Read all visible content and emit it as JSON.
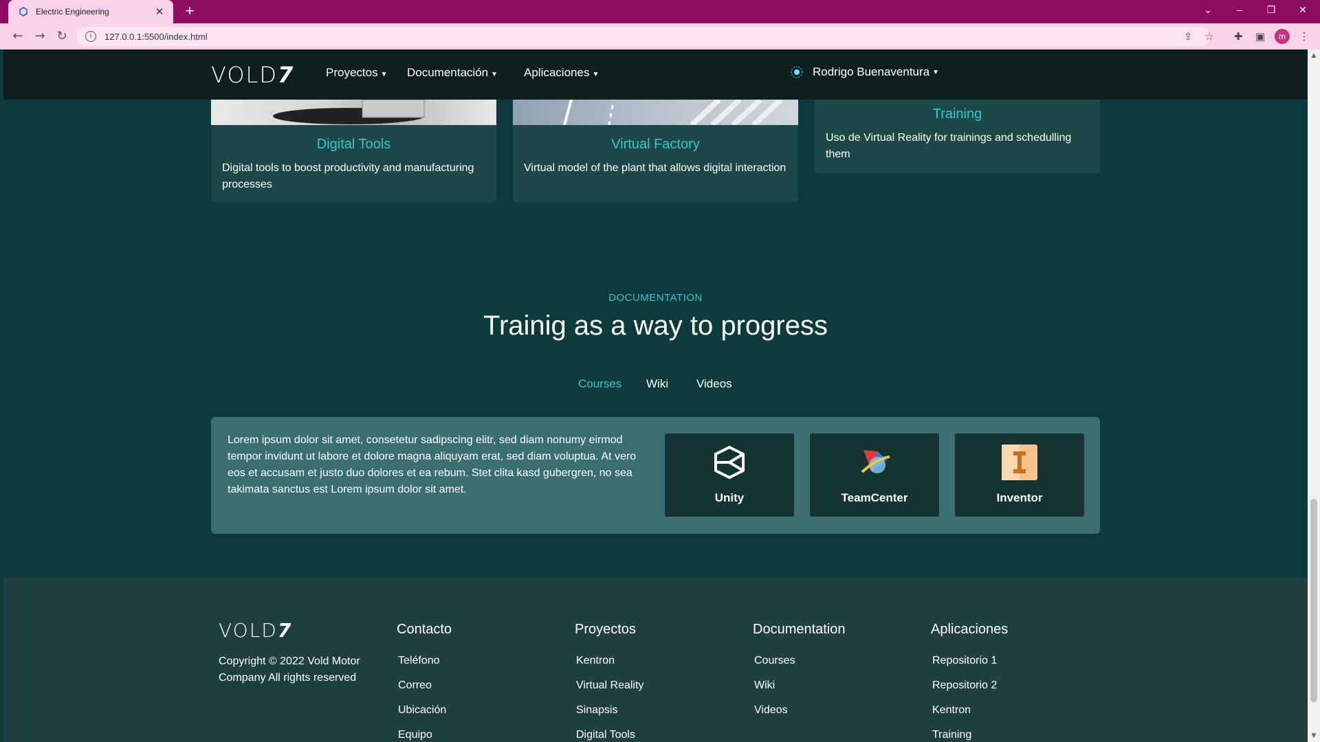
{
  "browser": {
    "tab_title": "Electric Engineering",
    "url": "127.0.0.1:5500/index.html",
    "profile_initial": "m"
  },
  "nav": {
    "logo": "VOLD",
    "logo_mark": "7",
    "menus": [
      "Proyectos",
      "Documentación",
      "Aplicaciones"
    ],
    "user": "Rodrigo Buenaventura"
  },
  "cards": [
    {
      "title": "Digital Tools",
      "text": "Digital tools to boost productivity and manufacturing processes"
    },
    {
      "title": "Virtual Factory",
      "text": "Virtual model of the plant that allows digital interaction"
    },
    {
      "title": "Training",
      "text": "Uso de Virtual Reality for trainings and schedulling them"
    }
  ],
  "documentation": {
    "kicker": "DOCUMENTATION",
    "heading": "Trainig as a way to progress",
    "tabs": [
      "Courses",
      "Wiki",
      "Videos"
    ],
    "active_tab": "Courses",
    "lorem": "Lorem ipsum dolor sit amet, consetetur sadipscing elitr, sed diam nonumy eirmod tempor invidunt ut labore et dolore magna aliquyam erat, sed diam voluptua. At vero eos et accusam et justo duo dolores et ea rebum. Stet clita kasd gubergren, no sea takimata sanctus est Lorem ipsum dolor sit amet.",
    "apps": [
      "Unity",
      "TeamCenter",
      "Inventor"
    ]
  },
  "footer": {
    "copyright": "Copyright © 2022 Vold Motor Company All rights reserved",
    "columns": [
      {
        "title": "Contacto",
        "links": [
          "Teléfono",
          "Correo",
          "Ubicación",
          "Equipo"
        ]
      },
      {
        "title": "Proyectos",
        "links": [
          "Kentron",
          "Virtual Reality",
          "Sinapsis",
          "Digital Tools"
        ]
      },
      {
        "title": "Documentation",
        "links": [
          "Courses",
          "Wiki",
          "Videos"
        ]
      },
      {
        "title": "Aplicaciones",
        "links": [
          "Repositorio 1",
          "Repositorio 2",
          "Kentron",
          "Training"
        ]
      }
    ]
  },
  "colors": {
    "accent": "#39c5cf",
    "page_bg": "#0d3b3b",
    "nav_bg": "#0f1e1e",
    "footer_bg": "#203f40",
    "browser_frame": "#8e0b62"
  }
}
